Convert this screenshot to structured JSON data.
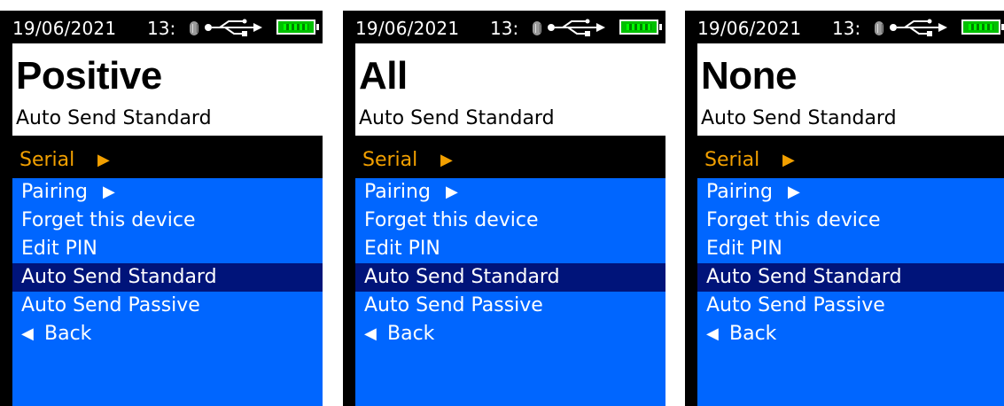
{
  "colors": {
    "background": "#000000",
    "header_bg": "#ffffff",
    "submenu_text": "#f2a000",
    "menu_bg": "#0066ff",
    "menu_selected_bg": "#00147a",
    "battery": "#00c000"
  },
  "icons": {
    "bluetooth": "bluetooth-icon",
    "usb": "usb-icon",
    "battery": "battery-icon",
    "arrow_right": "▶",
    "arrow_left": "◀"
  },
  "screens": [
    {
      "status": {
        "date": "19/06/2021",
        "time": "13:"
      },
      "header": {
        "mode_value": "Positive",
        "subtitle": "Auto Send Standard"
      },
      "submenu": {
        "label": "Serial"
      },
      "menu": {
        "items": [
          "Pairing",
          "Forget this device",
          "Edit PIN",
          "Auto Send Standard",
          "Auto Send Passive",
          "Back"
        ],
        "selected": "Auto Send Standard"
      }
    },
    {
      "status": {
        "date": "19/06/2021",
        "time": "13:"
      },
      "header": {
        "mode_value": "All",
        "subtitle": "Auto Send Standard"
      },
      "submenu": {
        "label": "Serial"
      },
      "menu": {
        "items": [
          "Pairing",
          "Forget this device",
          "Edit PIN",
          "Auto Send Standard",
          "Auto Send Passive",
          "Back"
        ],
        "selected": "Auto Send Standard"
      }
    },
    {
      "status": {
        "date": "19/06/2021",
        "time": "13:"
      },
      "header": {
        "mode_value": "None",
        "subtitle": "Auto Send Standard"
      },
      "submenu": {
        "label": "Serial"
      },
      "menu": {
        "items": [
          "Pairing",
          "Forget this device",
          "Edit PIN",
          "Auto Send Standard",
          "Auto Send Passive",
          "Back"
        ],
        "selected": "Auto Send Standard"
      }
    }
  ]
}
